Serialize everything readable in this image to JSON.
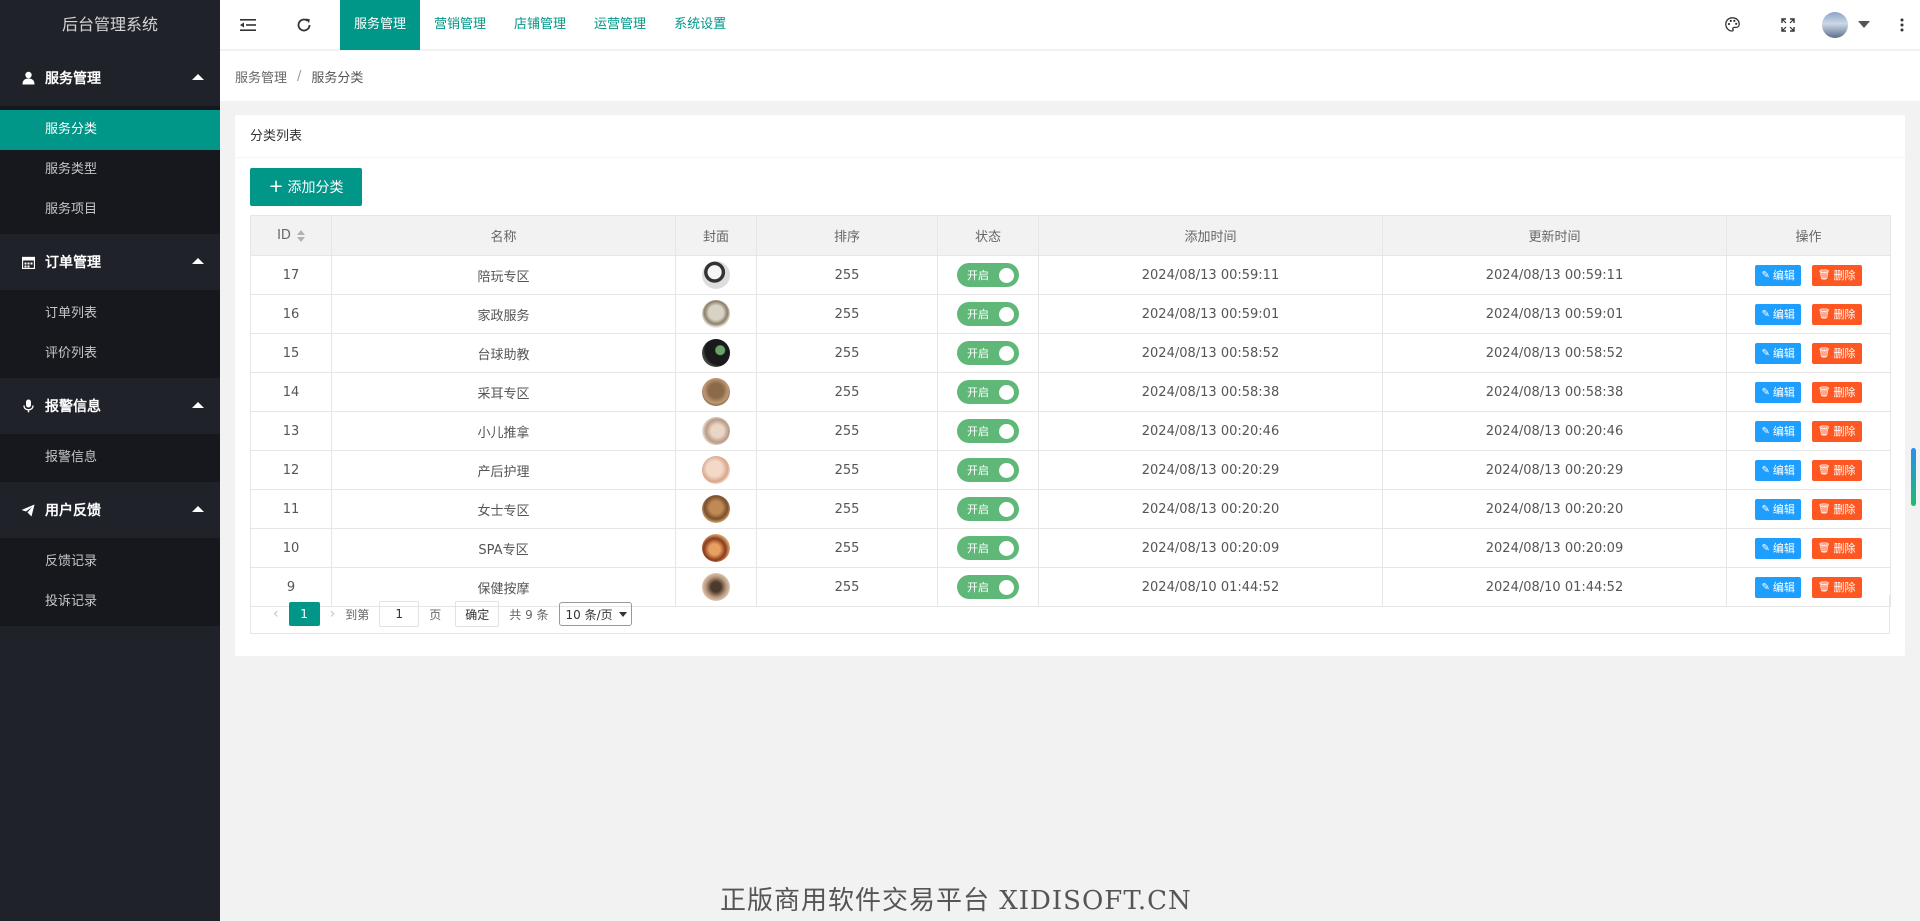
{
  "app": {
    "title": "后台管理系统"
  },
  "sidebar": {
    "groups": [
      {
        "label": "服务管理",
        "icon": "user-icon",
        "items": [
          {
            "label": "服务分类",
            "active": true
          },
          {
            "label": "服务类型"
          },
          {
            "label": "服务项目"
          }
        ]
      },
      {
        "label": "订单管理",
        "icon": "calendar-icon",
        "items": [
          {
            "label": "订单列表"
          },
          {
            "label": "评价列表"
          }
        ]
      },
      {
        "label": "报警信息",
        "icon": "microphone-icon",
        "items": [
          {
            "label": "报警信息"
          }
        ]
      },
      {
        "label": "用户反馈",
        "icon": "paper-plane-icon",
        "items": [
          {
            "label": "反馈记录"
          },
          {
            "label": "投诉记录"
          }
        ]
      }
    ]
  },
  "header": {
    "tabs": [
      {
        "label": "服务管理",
        "active": true
      },
      {
        "label": "营销管理"
      },
      {
        "label": "店铺管理"
      },
      {
        "label": "运营管理"
      },
      {
        "label": "系统设置"
      }
    ],
    "icons": [
      "menu-fold-icon",
      "refresh-icon",
      "palette-icon",
      "fullscreen-icon",
      "more-vertical-icon"
    ]
  },
  "breadcrumb": {
    "parent": "服务管理",
    "separator": "/",
    "current": "服务分类"
  },
  "card": {
    "title": "分类列表",
    "add_button": "添加分类",
    "columns": [
      "ID",
      "名称",
      "封面",
      "排序",
      "状态",
      "添加时间",
      "更新时间",
      "操作"
    ],
    "rows": [
      {
        "id": "17",
        "name": "陪玩专区",
        "sort": "255",
        "status": "开启",
        "created": "2024/08/13 00:59:11",
        "updated": "2024/08/13 00:59:11"
      },
      {
        "id": "16",
        "name": "家政服务",
        "sort": "255",
        "status": "开启",
        "created": "2024/08/13 00:59:01",
        "updated": "2024/08/13 00:59:01"
      },
      {
        "id": "15",
        "name": "台球助教",
        "sort": "255",
        "status": "开启",
        "created": "2024/08/13 00:58:52",
        "updated": "2024/08/13 00:58:52"
      },
      {
        "id": "14",
        "name": "采耳专区",
        "sort": "255",
        "status": "开启",
        "created": "2024/08/13 00:58:38",
        "updated": "2024/08/13 00:58:38"
      },
      {
        "id": "13",
        "name": "小儿推拿",
        "sort": "255",
        "status": "开启",
        "created": "2024/08/13 00:20:46",
        "updated": "2024/08/13 00:20:46"
      },
      {
        "id": "12",
        "name": "产后护理",
        "sort": "255",
        "status": "开启",
        "created": "2024/08/13 00:20:29",
        "updated": "2024/08/13 00:20:29"
      },
      {
        "id": "11",
        "name": "女士专区",
        "sort": "255",
        "status": "开启",
        "created": "2024/08/13 00:20:20",
        "updated": "2024/08/13 00:20:20"
      },
      {
        "id": "10",
        "name": "SPA专区",
        "sort": "255",
        "status": "开启",
        "created": "2024/08/13 00:20:09",
        "updated": "2024/08/13 00:20:09"
      },
      {
        "id": "9",
        "name": "保健按摩",
        "sort": "255",
        "status": "开启",
        "created": "2024/08/10 01:44:52",
        "updated": "2024/08/10 01:44:52"
      }
    ],
    "actions": {
      "edit": "编辑",
      "delete": "删除"
    }
  },
  "pager": {
    "current_page": "1",
    "goto_label": "到第",
    "goto_value": "1",
    "page_unit": "页",
    "confirm": "确定",
    "total": "共 9 条",
    "page_size": "10 条/页"
  },
  "watermark": "正版商用软件交易平台 XIDISOFT.CN",
  "colors": {
    "primary": "#009688",
    "sidebar_bg": "#20222a",
    "switch_on": "#5fb878",
    "edit": "#1e9fff",
    "delete": "#ff5722"
  }
}
